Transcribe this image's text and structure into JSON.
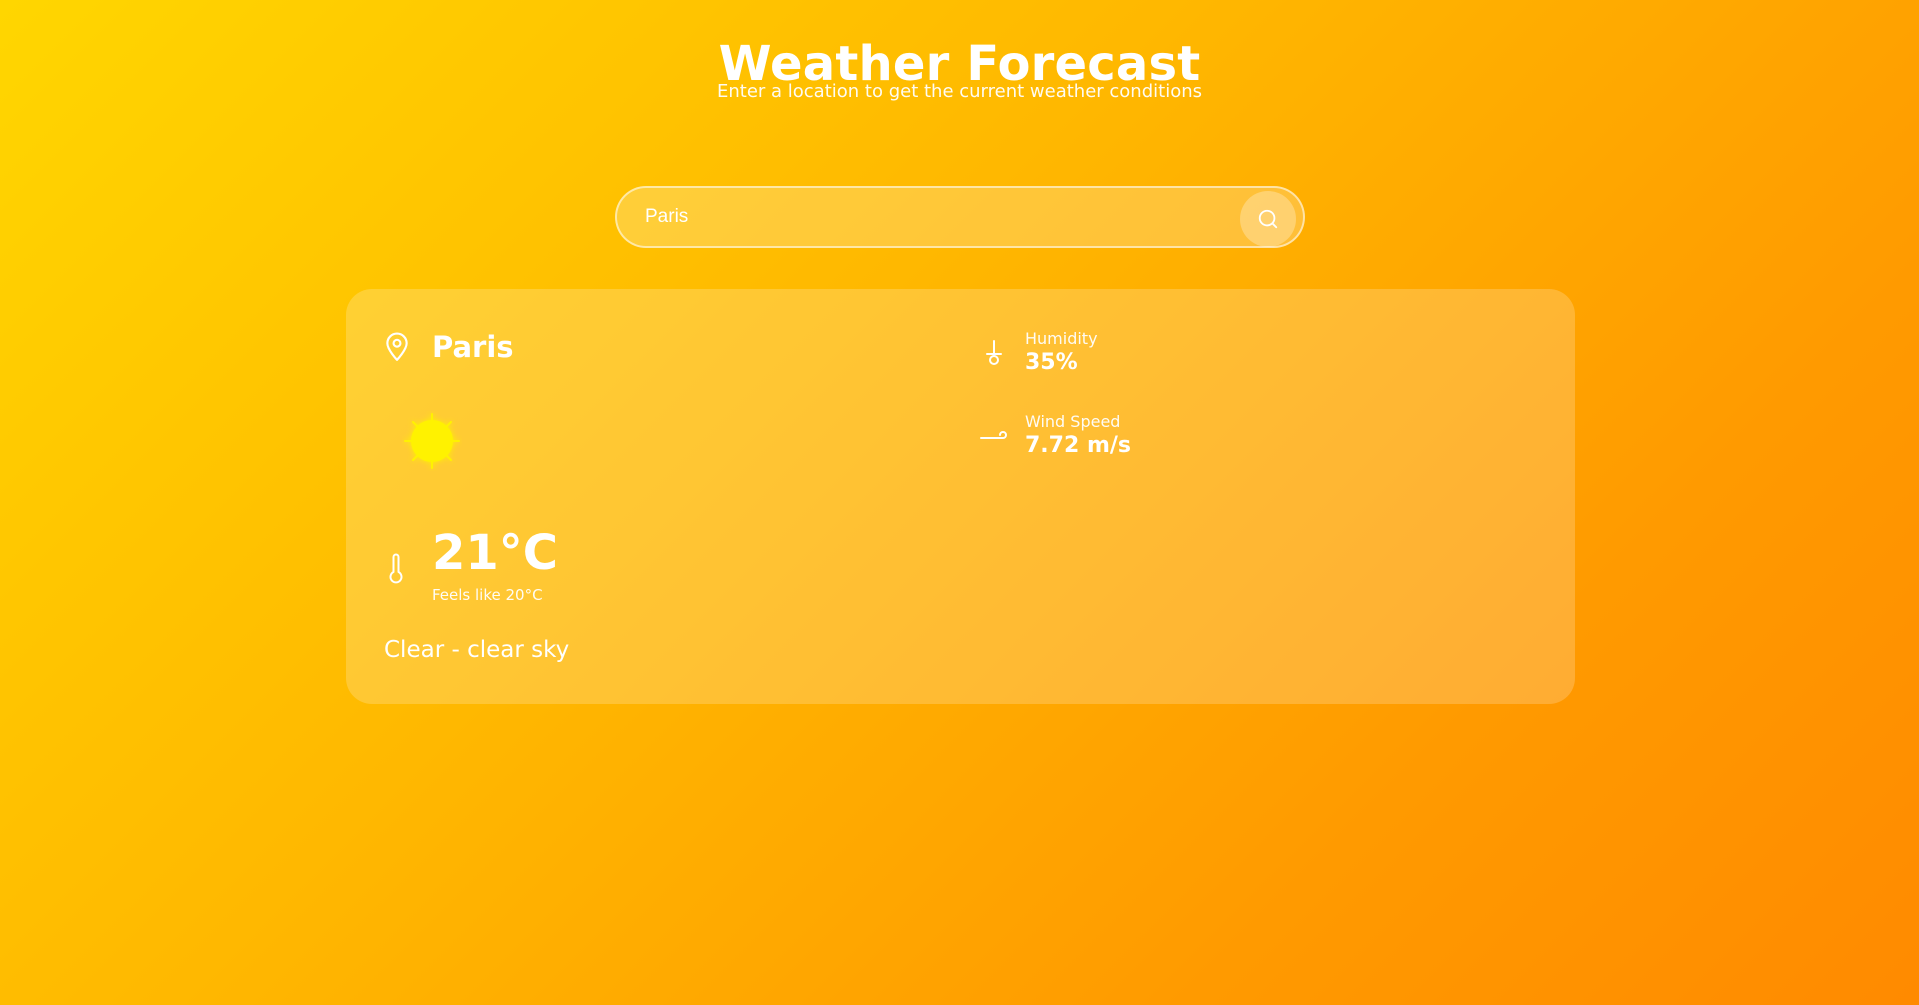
{
  "header": {
    "title": "Weather Forecast",
    "subtitle": "Enter a location to get the current weather conditions"
  },
  "search": {
    "value": "Paris",
    "icon": "search-icon"
  },
  "weather": {
    "city": "Paris",
    "location_icon": "map-pin-icon",
    "condition_icon": "sun-icon",
    "temperature": "21°C",
    "feels_like": "Feels like 20°C",
    "description": "Clear - clear sky",
    "humidity": {
      "label": "Humidity",
      "value": "35%",
      "icon": "humidity-icon"
    },
    "wind": {
      "label": "Wind Speed",
      "value": "7.72 m/s",
      "icon": "wind-icon"
    }
  },
  "colors": {
    "gradient_start": "#FFD600",
    "gradient_end": "#FF8A00",
    "sun": "#FFF200",
    "text": "#FFFFFF"
  }
}
